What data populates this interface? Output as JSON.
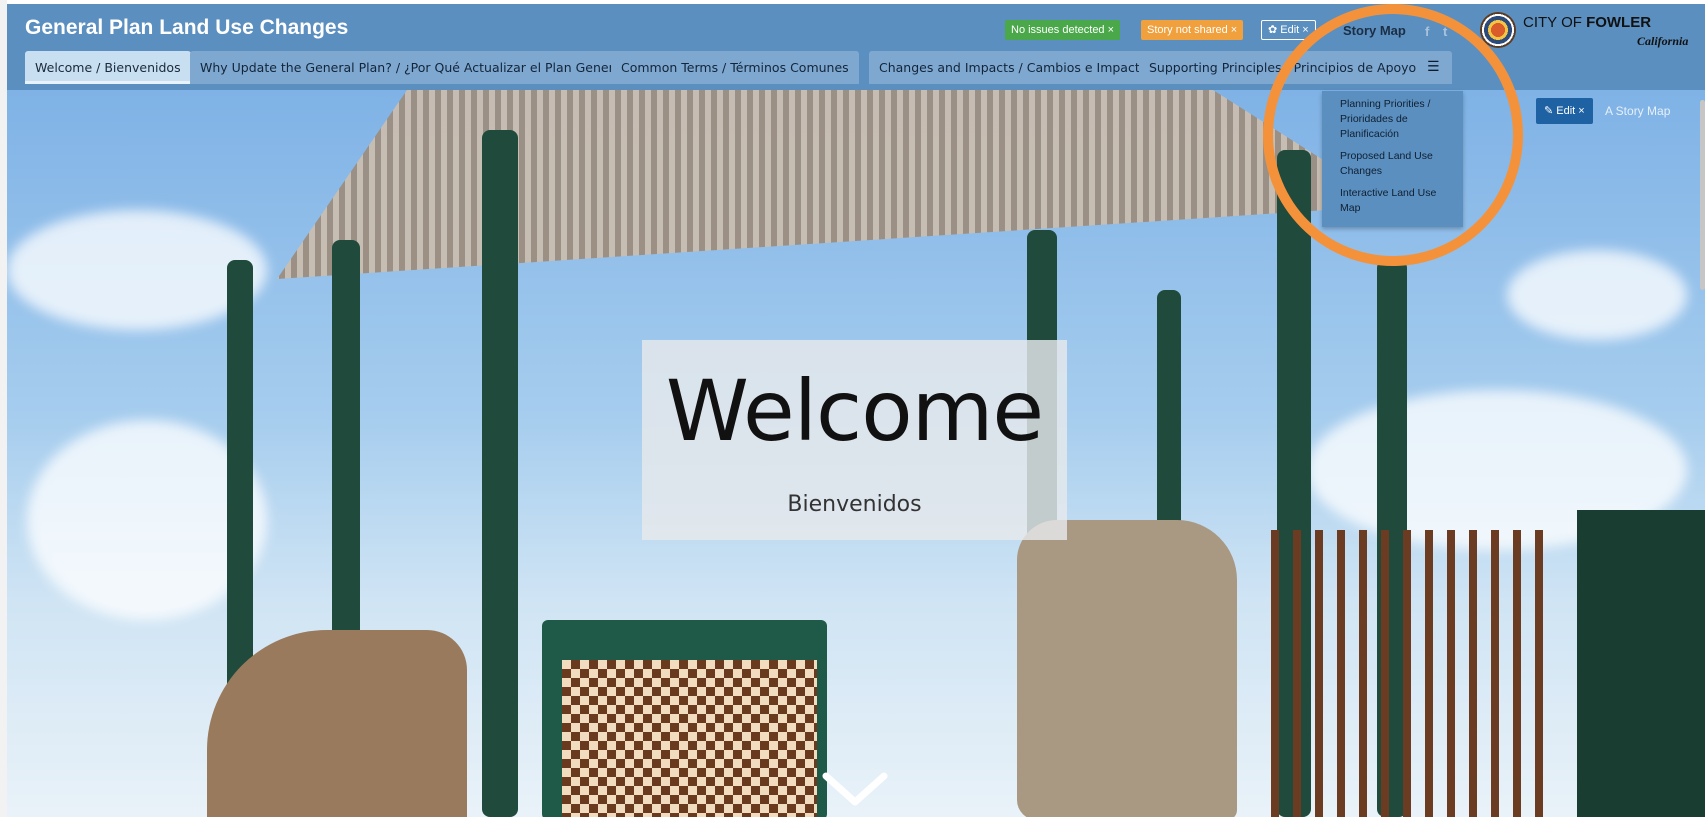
{
  "header": {
    "title": "General Plan Land Use Changes",
    "badges": {
      "issues": "No issues detected ×",
      "shared": "Story not shared ×",
      "edit": "✿ Edit ×"
    },
    "story_map_label": "Story Map",
    "social": {
      "facebook": "f",
      "twitter": "t"
    },
    "logo": {
      "city": "CITY OF ",
      "city_bold": "FOWLER",
      "state": "California"
    }
  },
  "tabs": [
    {
      "label": "Welcome / Bienvenidos",
      "active": true
    },
    {
      "label": "Why Update the General Plan? / ¿Por Qué Actualizar el Plan General?"
    },
    {
      "label": "Common Terms / Términos Comunes"
    },
    {
      "label": "Changes and Impacts / Cambios e Impactos"
    },
    {
      "label": "Supporting Principles / Principios de Apoyo"
    }
  ],
  "tab_menu": {
    "icon": "list-icon",
    "glyph": "☰",
    "items": [
      {
        "label": "Planning Priorities / Prioridades de Planificación"
      },
      {
        "label": "Proposed Land Use Changes"
      },
      {
        "label": "Interactive Land Use Map"
      }
    ]
  },
  "hero": {
    "title": "Welcome",
    "subtitle": "Bienvenidos",
    "edit_label": "✎ Edit ×",
    "story_map_label": "A Story Map"
  },
  "colors": {
    "header": "#5b8fc0",
    "annotation": "#f4923c",
    "accent": "#1f62a4"
  }
}
